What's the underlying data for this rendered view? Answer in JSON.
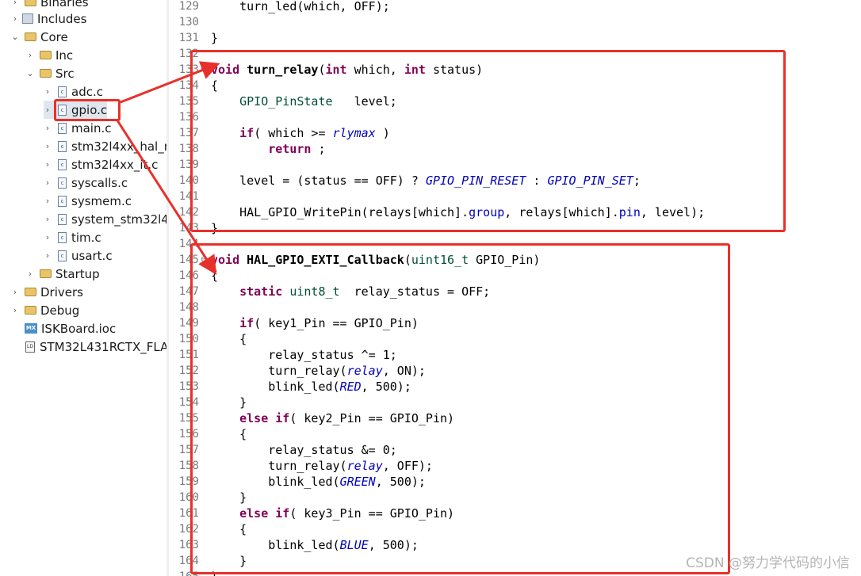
{
  "project_tree": {
    "items": [
      {
        "label": "Binaries",
        "icon": "binaries-icon",
        "expanded": false
      },
      {
        "label": "Includes",
        "icon": "includes-icon",
        "expanded": false
      },
      {
        "label": "Core",
        "icon": "folder-icon",
        "expanded": true
      },
      {
        "label": "Inc",
        "icon": "folder-icon",
        "expanded": false
      },
      {
        "label": "Src",
        "icon": "folder-icon",
        "expanded": true
      },
      {
        "label": "adc.c",
        "icon": "c-file-icon"
      },
      {
        "label": "gpio.c",
        "icon": "c-file-icon",
        "selected": true
      },
      {
        "label": "main.c",
        "icon": "c-file-icon"
      },
      {
        "label": "stm32l4xx_hal_m",
        "icon": "c-file-icon"
      },
      {
        "label": "stm32l4xx_it.c",
        "icon": "c-file-icon"
      },
      {
        "label": "syscalls.c",
        "icon": "c-file-icon"
      },
      {
        "label": "sysmem.c",
        "icon": "c-file-icon"
      },
      {
        "label": "system_stm32l4",
        "icon": "c-file-icon"
      },
      {
        "label": "tim.c",
        "icon": "c-file-icon"
      },
      {
        "label": "usart.c",
        "icon": "c-file-icon"
      },
      {
        "label": "Startup",
        "icon": "folder-icon",
        "expanded": false
      },
      {
        "label": "Drivers",
        "icon": "folder-icon",
        "expanded": false
      },
      {
        "label": "Debug",
        "icon": "folder-icon",
        "expanded": false
      },
      {
        "label": "ISKBoard.ioc",
        "icon": "mx-file-icon"
      },
      {
        "label": "STM32L431RCTX_FLA",
        "icon": "ld-file-icon"
      }
    ]
  },
  "editor": {
    "lines": [
      {
        "n": "129",
        "t": "    turn_led(which, OFF);"
      },
      {
        "n": "130",
        "t": ""
      },
      {
        "n": "131",
        "t": "}"
      },
      {
        "n": "132",
        "t": ""
      },
      {
        "n": "133",
        "t": "void turn_relay(int which, int status)",
        "fold": true
      },
      {
        "n": "134",
        "t": "{"
      },
      {
        "n": "135",
        "t": "    GPIO_PinState   level;"
      },
      {
        "n": "136",
        "t": ""
      },
      {
        "n": "137",
        "t": "    if( which >= rlymax )"
      },
      {
        "n": "138",
        "t": "        return ;"
      },
      {
        "n": "139",
        "t": ""
      },
      {
        "n": "140",
        "t": "    level = (status == OFF) ? GPIO_PIN_RESET : GPIO_PIN_SET;"
      },
      {
        "n": "141",
        "t": ""
      },
      {
        "n": "142",
        "t": "    HAL_GPIO_WritePin(relays[which].group, relays[which].pin, level);"
      },
      {
        "n": "143",
        "t": "}"
      },
      {
        "n": "144",
        "t": ""
      },
      {
        "n": "145",
        "t": "void HAL_GPIO_EXTI_Callback(uint16_t GPIO_Pin)",
        "fold": true
      },
      {
        "n": "146",
        "t": "{"
      },
      {
        "n": "147",
        "t": "    static uint8_t  relay_status = OFF;"
      },
      {
        "n": "148",
        "t": ""
      },
      {
        "n": "149",
        "t": "    if( key1_Pin == GPIO_Pin)"
      },
      {
        "n": "150",
        "t": "    {"
      },
      {
        "n": "151",
        "t": "        relay_status ^= 1;"
      },
      {
        "n": "152",
        "t": "        turn_relay(relay, ON);"
      },
      {
        "n": "153",
        "t": "        blink_led(RED, 500);"
      },
      {
        "n": "154",
        "t": "    }"
      },
      {
        "n": "155",
        "t": "    else if( key2_Pin == GPIO_Pin)"
      },
      {
        "n": "156",
        "t": "    {"
      },
      {
        "n": "157",
        "t": "        relay_status &= 0;"
      },
      {
        "n": "158",
        "t": "        turn_relay(relay, OFF);"
      },
      {
        "n": "159",
        "t": "        blink_led(GREEN, 500);"
      },
      {
        "n": "160",
        "t": "    }"
      },
      {
        "n": "161",
        "t": "    else if( key3_Pin == GPIO_Pin)"
      },
      {
        "n": "162",
        "t": "    {"
      },
      {
        "n": "163",
        "t": "        blink_led(BLUE, 500);"
      },
      {
        "n": "164",
        "t": "    }"
      },
      {
        "n": "165",
        "t": "}"
      }
    ],
    "keywords": [
      "void",
      "int",
      "if",
      "return",
      "static",
      "else"
    ],
    "types": [
      "GPIO_PinState",
      "uint8_t",
      "uint16_t"
    ],
    "macros": [
      "rlymax",
      "GPIO_PIN_RESET",
      "GPIO_PIN_SET",
      "relay",
      "RED",
      "GREEN",
      "BLUE"
    ],
    "fields": [
      "group",
      "pin"
    ],
    "functions": [
      "turn_relay",
      "HAL_GPIO_EXTI_Callback"
    ]
  },
  "watermark": "CSDN @努力学代码的小信",
  "colors": {
    "annotation": "#e8302a",
    "keyword": "#7f0055",
    "type": "#005032",
    "macro": "#0000c0"
  }
}
